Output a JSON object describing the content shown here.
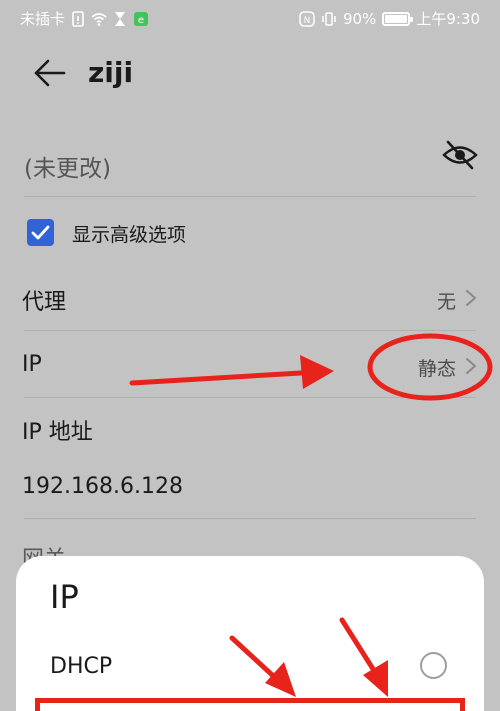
{
  "status_bar": {
    "carrier": "未插卡",
    "battery_percent": "90%",
    "time": "上午9:30"
  },
  "header": {
    "title": "ziji",
    "back_icon": "back-arrow-icon"
  },
  "password": {
    "value": "(未更改)",
    "toggle_icon": "eye-off-icon"
  },
  "advanced": {
    "label": "显示高级选项",
    "checked": true
  },
  "settings": {
    "proxy": {
      "label": "代理",
      "value": "无"
    },
    "ip": {
      "label": "IP",
      "value": "静态"
    },
    "ip_address": {
      "label": "IP 地址",
      "value": "192.168.6.128"
    },
    "gateway_partial": "网关"
  },
  "sheet": {
    "title": "IP",
    "options": [
      {
        "label": "DHCP",
        "selected": false
      }
    ]
  },
  "colors": {
    "background": "#c3c3c3",
    "accent": "#2f63d6",
    "annotation": "#e8231b"
  }
}
